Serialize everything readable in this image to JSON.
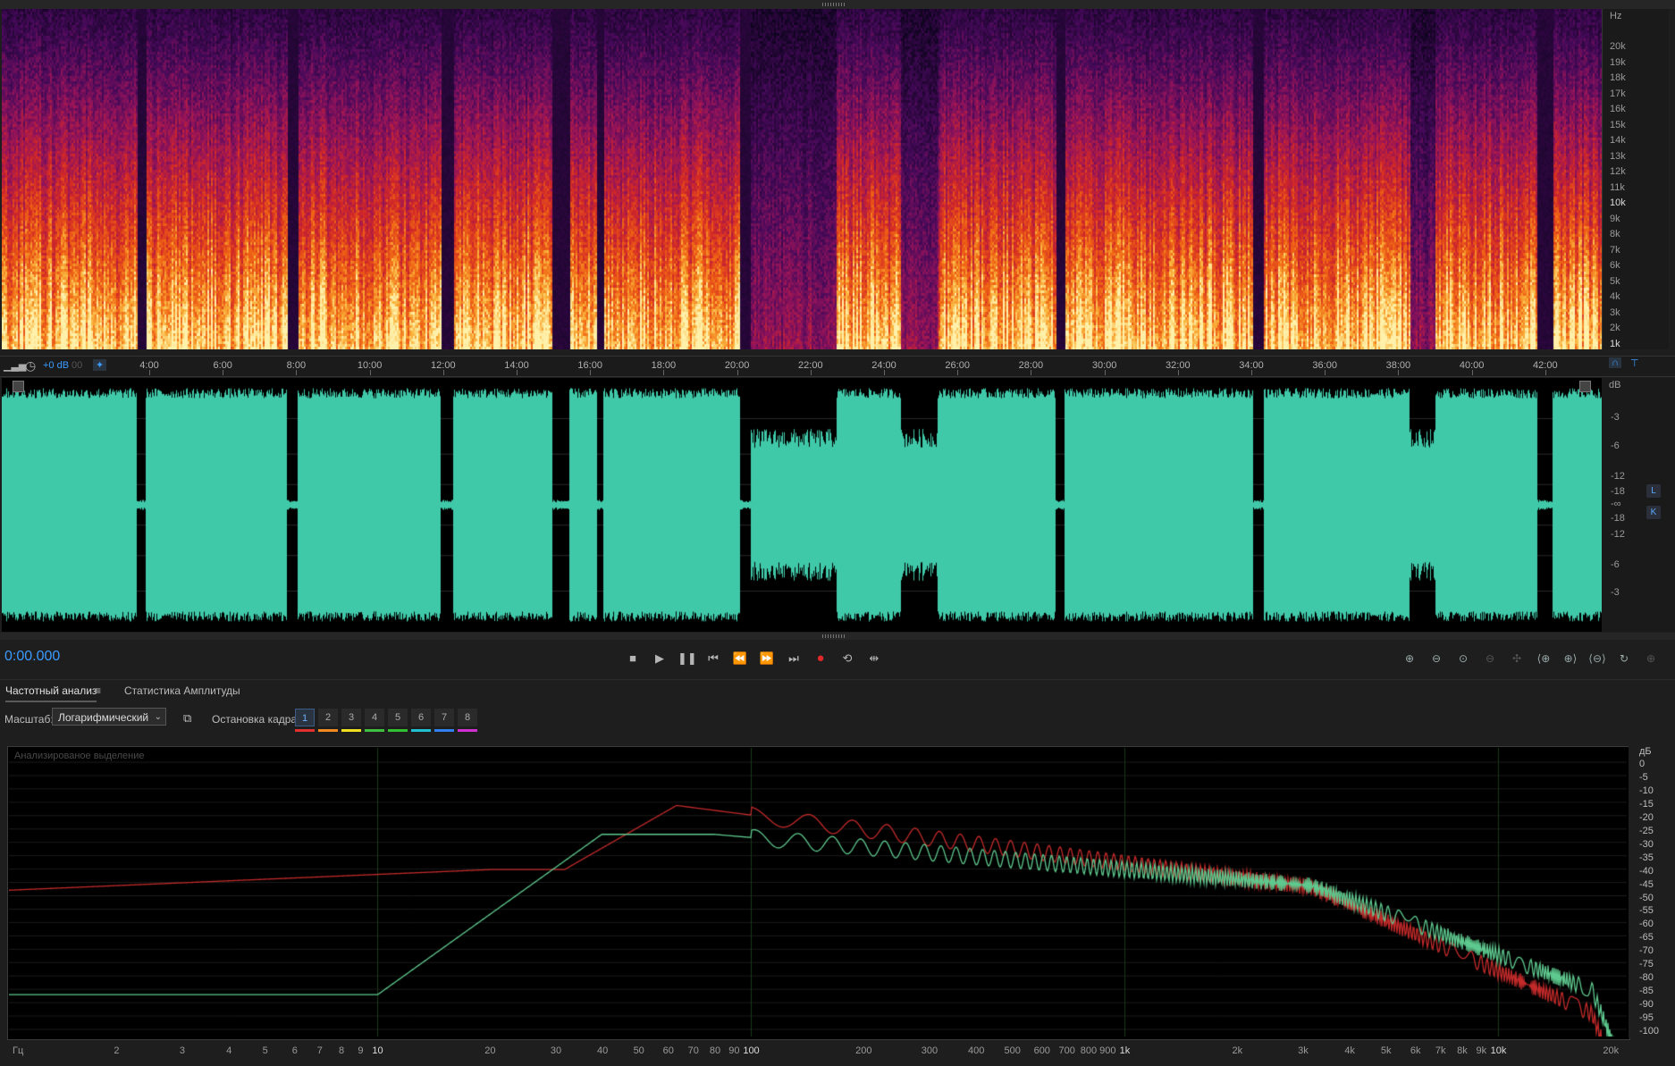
{
  "colors": {
    "waveform": "#40c9a9",
    "playhead_time": "#3b9bff",
    "record": "#e02828",
    "trace_red": "#c42a2a",
    "trace_green": "#5ec98e",
    "accent": "#3b9bff"
  },
  "spectrogram": {
    "unit": "Hz",
    "freq_labels": [
      "20k",
      "19k",
      "18k",
      "17k",
      "16k",
      "15k",
      "14k",
      "13k",
      "12k",
      "11k",
      "10k",
      "9k",
      "8k",
      "7k",
      "6k",
      "5k",
      "4k",
      "3k",
      "2k",
      "1k"
    ]
  },
  "timeline": {
    "gain_label": "+0 dB",
    "hidden_zero": "00",
    "labels": [
      "4:00",
      "6:00",
      "8:00",
      "10:00",
      "12:00",
      "14:00",
      "16:00",
      "18:00",
      "20:00",
      "22:00",
      "24:00",
      "26:00",
      "28:00",
      "30:00",
      "32:00",
      "34:00",
      "36:00",
      "38:00",
      "40:00",
      "42:00"
    ]
  },
  "waveform": {
    "unit": "dB",
    "db_labels_top": [
      "-3",
      "-6",
      "-12",
      "-18"
    ],
    "inf_label": "-∞",
    "db_labels_bottom": [
      "-18",
      "-12",
      "-6",
      "-3"
    ],
    "channel_left": "L",
    "channel_right": "K"
  },
  "transport": {
    "time": "0:00.000",
    "buttons": [
      "stop",
      "play",
      "pause",
      "to-start",
      "rewind",
      "fast-forward",
      "to-end",
      "record",
      "loop",
      "skip-selection"
    ]
  },
  "panel": {
    "tabs": [
      "Частотный анализ",
      "Статистика Амплитуды"
    ],
    "menu_icon": "≡",
    "scale_label": "Масштаб:",
    "scale_value": "Логарифмический",
    "freeze_label": "Остановка кадра:",
    "frames": [
      "1",
      "2",
      "3",
      "4",
      "5",
      "6",
      "7",
      "8"
    ],
    "frame_colors": [
      "#e03030",
      "#f08a20",
      "#f0e020",
      "#40c040",
      "#30c030",
      "#20c0d0",
      "#3080f0",
      "#d030d0"
    ],
    "active_frame": "1"
  },
  "freq_graph": {
    "caption": "Анализированое выделение",
    "x_unit": "Гц",
    "y_unit": "дБ",
    "x_labels": [
      "2",
      "3",
      "4",
      "5",
      "6",
      "7",
      "8",
      "9",
      "10",
      "20",
      "30",
      "40",
      "50",
      "60",
      "70",
      "80",
      "90",
      "100",
      "200",
      "300",
      "400",
      "500",
      "600",
      "700",
      "800",
      "900",
      "1k",
      "2k",
      "3k",
      "4k",
      "5k",
      "6k",
      "7k",
      "8k",
      "9k",
      "10k",
      "20k"
    ],
    "y_labels": [
      "0",
      "-5",
      "-10",
      "-15",
      "-20",
      "-25",
      "-30",
      "-35",
      "-40",
      "-45",
      "-50",
      "-55",
      "-60",
      "-65",
      "-70",
      "-75",
      "-80",
      "-85",
      "-90",
      "-95",
      "-100"
    ]
  }
}
